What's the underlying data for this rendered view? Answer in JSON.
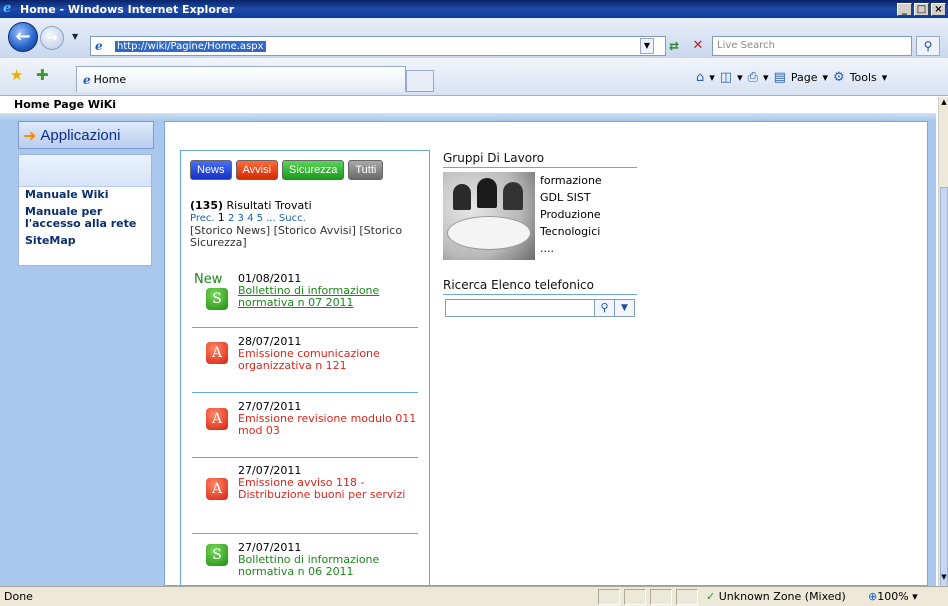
{
  "window": {
    "title": "Home - Windows Internet Explorer",
    "min": "_",
    "max": "□",
    "close": "×"
  },
  "address": {
    "url": "http://wiki/Pagine/Home.aspx",
    "search_placeholder": "Live Search"
  },
  "tab": {
    "label": "Home"
  },
  "toolbar": {
    "page_label": "Page",
    "tools_label": "Tools"
  },
  "page": {
    "header": "Home Page WiKi",
    "applicazioni": "Applicazioni",
    "menu": [
      "Manuale Wiki",
      "Manuale per l'accesso alla rete",
      "SiteMap"
    ]
  },
  "news": {
    "tabs": [
      "News",
      "Avvisi",
      "Sicurezza",
      "Tutti"
    ],
    "count": "(135)",
    "results_label": "Risultati Trovati",
    "prev": "Prec.",
    "pages": [
      "1",
      "2",
      "3",
      "4",
      "5"
    ],
    "next": "... Succ.",
    "storico": "[Storico News] [Storico Avvisi] [Storico Sicurezza]",
    "new_label": "New",
    "items": [
      {
        "badge": "S",
        "date": "01/08/2011",
        "text": "Bollettino di informazione normativa n 07 2011",
        "color": "green"
      },
      {
        "badge": "A",
        "date": "28/07/2011",
        "text": "Emissione comunicazione organizzativa n 121",
        "color": "red"
      },
      {
        "badge": "A",
        "date": "27/07/2011",
        "text": "Emissione revisione modulo 011 mod 03",
        "color": "red"
      },
      {
        "badge": "A",
        "date": "27/07/2011",
        "text": "Emissione avviso 118 - Distribuzione buoni per servizi",
        "color": "red"
      },
      {
        "badge": "S",
        "date": "27/07/2011",
        "text": "Bollettino di informazione normativa n 06 2011",
        "color": "green"
      }
    ]
  },
  "gruppi": {
    "title": "Gruppi Di Lavoro",
    "items": [
      "formazione",
      "GDL SIST",
      "Produzione",
      "Tecnologici",
      "...."
    ]
  },
  "ricerca": {
    "title": "Ricerca Elenco telefonico"
  },
  "status": {
    "left": "Done",
    "zone": "Unknown Zone (Mixed)",
    "zoom": "100%"
  }
}
